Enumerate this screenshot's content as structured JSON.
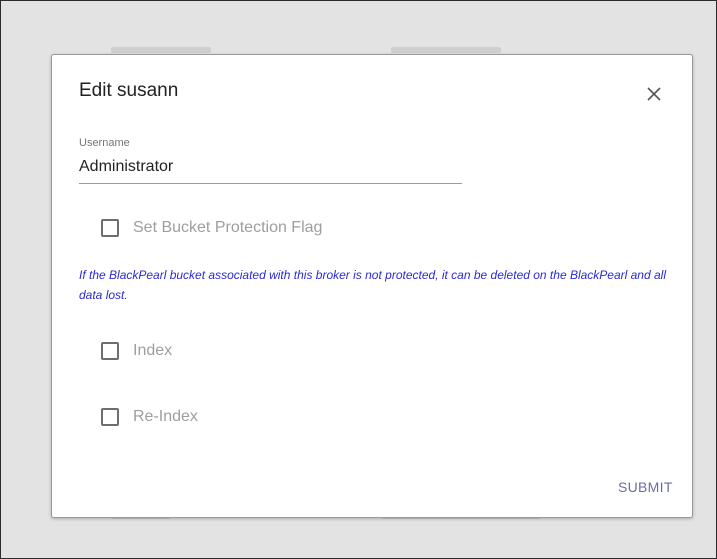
{
  "dialog": {
    "title": "Edit susann",
    "close_icon": "close-icon",
    "username": {
      "label": "Username",
      "value": "Administrator"
    },
    "checkboxes": {
      "bucket_protection": {
        "label": "Set Bucket Protection Flag",
        "checked": false
      },
      "index": {
        "label": "Index",
        "checked": false
      },
      "reindex": {
        "label": "Re-Index",
        "checked": false
      }
    },
    "warning_text": "If the BlackPearl bucket associated with this broker is not protected, it can be deleted on the BlackPearl and all data lost.",
    "submit_label": "SUBMIT"
  },
  "colors": {
    "warning": "#2b2bd6",
    "submit": "#6b6ba8",
    "backdrop": "#e3e3e3"
  }
}
